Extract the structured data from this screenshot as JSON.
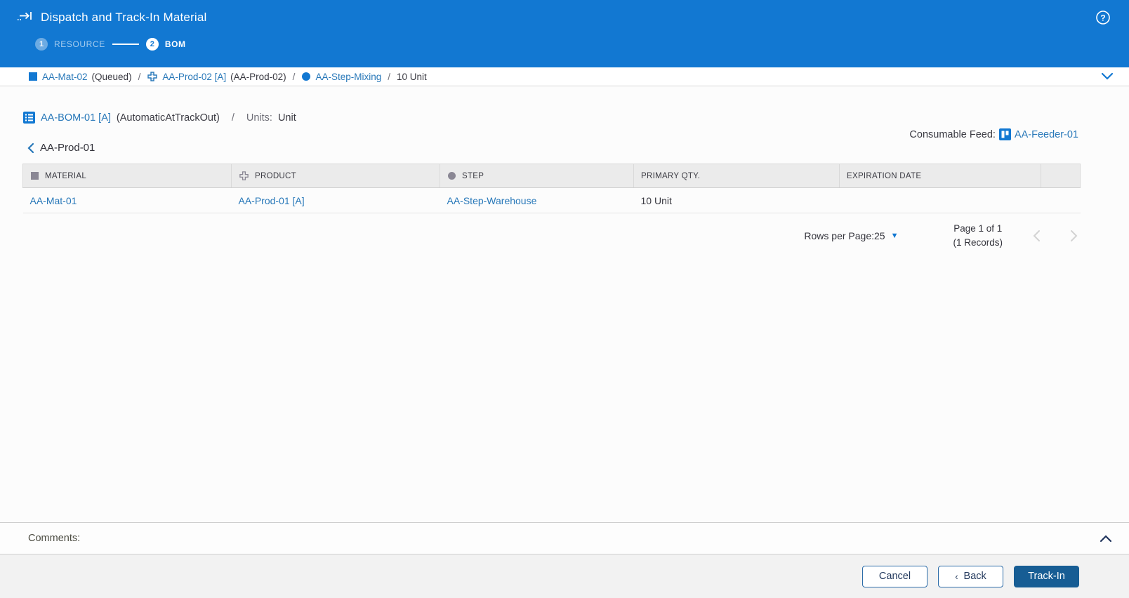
{
  "header": {
    "title": "Dispatch and Track-In Material",
    "steps": [
      {
        "number": "1",
        "label": "RESOURCE",
        "state": "done"
      },
      {
        "number": "2",
        "label": "BOM",
        "state": "active"
      }
    ]
  },
  "breadcrumb": {
    "material_link": "AA-Mat-02",
    "material_status": "(Queued)",
    "sep1": "/",
    "product_link": "AA-Prod-02 [A]",
    "product_detail": "(AA-Prod-02)",
    "sep2": "/",
    "step_link": "AA-Step-Mixing",
    "sep3": "/",
    "quantity": "10 Unit"
  },
  "bom": {
    "name": "AA-BOM-01 [A]",
    "mode": "(AutomaticAtTrackOut)",
    "sep": "/",
    "units_label": "Units:",
    "units_value": "Unit",
    "consumable_feed_label": "Consumable Feed:",
    "consumable_feed_value": "AA-Feeder-01",
    "back_chevron": "‹",
    "back_link": "AA-Prod-01"
  },
  "table": {
    "columns": [
      {
        "label": "MATERIAL"
      },
      {
        "label": "PRODUCT"
      },
      {
        "label": "STEP"
      },
      {
        "label": "PRIMARY QTY."
      },
      {
        "label": "EXPIRATION DATE"
      },
      {
        "label": ""
      }
    ],
    "rows": [
      {
        "material": "AA-Mat-01",
        "product": "AA-Prod-01 [A]",
        "step": "AA-Step-Warehouse",
        "primary_qty": "10 Unit",
        "expiration_date": ""
      }
    ]
  },
  "pagination": {
    "rows_per_page_label": "Rows per Page:",
    "rows_per_page_value": "25",
    "page_info": "Page 1 of 1",
    "records_info": "(1 Records)"
  },
  "comments": {
    "label": "Comments:"
  },
  "footer": {
    "cancel_label": "Cancel",
    "back_chevron": "‹",
    "back_label": "Back",
    "track_in_label": "Track-In"
  },
  "colors": {
    "header_blue": "#1278d2",
    "link_blue": "#2878b9",
    "primary_button": "#175d94",
    "table_header_bg": "#ebebeb",
    "footer_bg": "#f2f2f2"
  }
}
